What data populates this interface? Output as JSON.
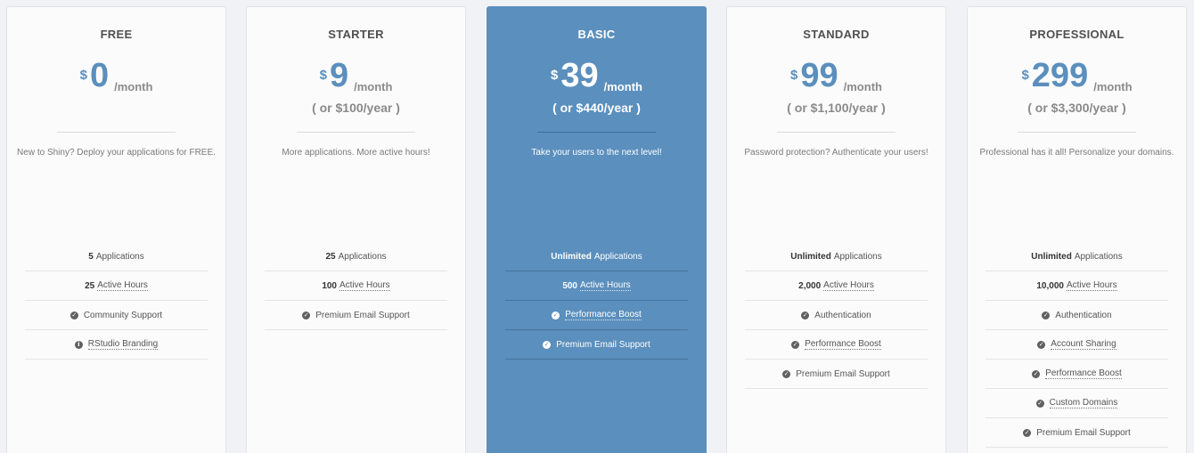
{
  "plans": [
    {
      "name": "FREE",
      "currency": "$",
      "amount": "0",
      "per": "/month",
      "yearly": "",
      "description": "New to Shiny? Deploy your applications for FREE.",
      "features": [
        {
          "bold": "5",
          "text": "Applications",
          "icon": "",
          "dotted": false
        },
        {
          "bold": "25",
          "text": "Active Hours",
          "icon": "",
          "dotted": true
        },
        {
          "bold": "",
          "text": "Community Support",
          "icon": "check-circle-icon",
          "dotted": false
        },
        {
          "bold": "",
          "text": "RStudio Branding",
          "icon": "info-circle-icon",
          "dotted": true
        }
      ]
    },
    {
      "name": "STARTER",
      "currency": "$",
      "amount": "9",
      "per": "/month",
      "yearly": "( or $100/year )",
      "description": "More applications. More active hours!",
      "features": [
        {
          "bold": "25",
          "text": "Applications",
          "icon": "",
          "dotted": false
        },
        {
          "bold": "100",
          "text": "Active Hours",
          "icon": "",
          "dotted": true
        },
        {
          "bold": "",
          "text": "Premium Email Support",
          "icon": "check-circle-icon",
          "dotted": false
        }
      ]
    },
    {
      "name": "BASIC",
      "currency": "$",
      "amount": "39",
      "per": "/month",
      "yearly": "( or $440/year )",
      "description": "Take your users to the next level!",
      "features": [
        {
          "bold": "Unlimited",
          "text": "Applications",
          "icon": "",
          "dotted": false
        },
        {
          "bold": "500",
          "text": "Active Hours",
          "icon": "",
          "dotted": true
        },
        {
          "bold": "",
          "text": "Performance Boost",
          "icon": "check-circle-icon",
          "dotted": true
        },
        {
          "bold": "",
          "text": "Premium Email Support",
          "icon": "check-circle-icon",
          "dotted": false
        }
      ]
    },
    {
      "name": "STANDARD",
      "currency": "$",
      "amount": "99",
      "per": "/month",
      "yearly": "( or $1,100/year )",
      "description": "Password protection? Authenticate your users!",
      "features": [
        {
          "bold": "Unlimited",
          "text": "Applications",
          "icon": "",
          "dotted": false
        },
        {
          "bold": "2,000",
          "text": "Active Hours",
          "icon": "",
          "dotted": true
        },
        {
          "bold": "",
          "text": "Authentication",
          "icon": "check-circle-icon",
          "dotted": false
        },
        {
          "bold": "",
          "text": "Performance Boost",
          "icon": "check-circle-icon",
          "dotted": true
        },
        {
          "bold": "",
          "text": "Premium Email Support",
          "icon": "check-circle-icon",
          "dotted": false
        }
      ]
    },
    {
      "name": "PROFESSIONAL",
      "currency": "$",
      "amount": "299",
      "per": "/month",
      "yearly": "( or $3,300/year )",
      "description": "Professional has it all! Personalize your domains.",
      "features": [
        {
          "bold": "Unlimited",
          "text": "Applications",
          "icon": "",
          "dotted": false
        },
        {
          "bold": "10,000",
          "text": "Active Hours",
          "icon": "",
          "dotted": true
        },
        {
          "bold": "",
          "text": "Authentication",
          "icon": "check-circle-icon",
          "dotted": false
        },
        {
          "bold": "",
          "text": "Account Sharing",
          "icon": "check-circle-icon",
          "dotted": true
        },
        {
          "bold": "",
          "text": "Performance Boost",
          "icon": "check-circle-icon",
          "dotted": true
        },
        {
          "bold": "",
          "text": "Custom Domains",
          "icon": "check-circle-icon",
          "dotted": true
        },
        {
          "bold": "",
          "text": "Premium Email Support",
          "icon": "check-circle-icon",
          "dotted": false
        }
      ]
    }
  ],
  "colors": {
    "accent": "#5b8fbd",
    "page_background": "#f1f2f6",
    "card_background": "#fbfbfb"
  }
}
